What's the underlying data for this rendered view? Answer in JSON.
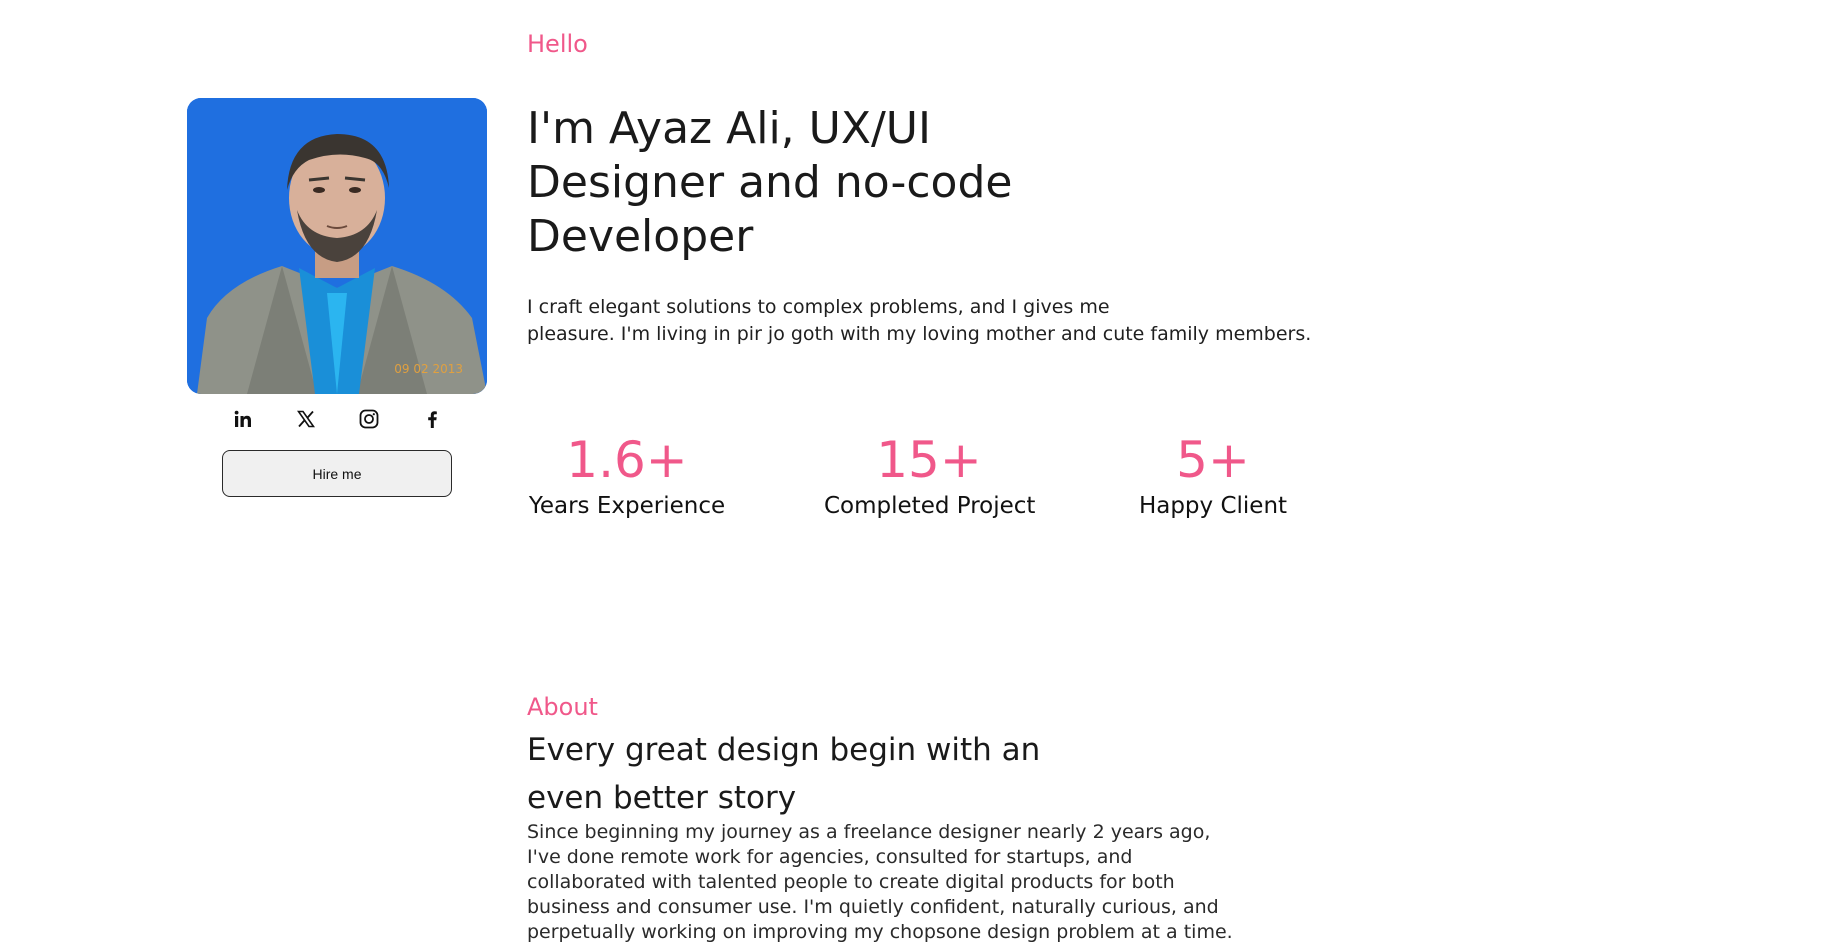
{
  "hero": {
    "greeting": "Hello",
    "title_lines": [
      "I'm Ayaz Ali, UX/UI",
      "Designer and no-code",
      "Developer"
    ],
    "intro_lines": [
      "I craft elegant solutions to complex problems, and I gives me",
      "pleasure. I'm living in pir jo goth with my loving mother and cute family members."
    ]
  },
  "profile": {
    "photo_stamp": "09 02 2013",
    "social": [
      {
        "name": "linkedin-icon"
      },
      {
        "name": "x-icon"
      },
      {
        "name": "instagram-icon"
      },
      {
        "name": "facebook-icon"
      }
    ],
    "hire_label": "Hire me"
  },
  "stats": [
    {
      "value": "1.6+",
      "label": "Years Experience"
    },
    {
      "value": "15+",
      "label": "Completed Project"
    },
    {
      "value": "5+",
      "label": "Happy Client"
    }
  ],
  "about": {
    "label": "About",
    "title_lines": [
      "Every great design begin with an",
      "even better story"
    ],
    "body_lines": [
      "Since beginning my journey as a freelance designer nearly 2 years ago,",
      "I've done remote work for agencies, consulted for startups, and",
      "collaborated with talented people to create digital products for both",
      "business and consumer use. I'm quietly confident, naturally curious, and",
      "perpetually working on improving my chopsone design problem at a time."
    ]
  },
  "colors": {
    "accent": "#f0588a",
    "photo_bg": "#1f6fe0"
  }
}
